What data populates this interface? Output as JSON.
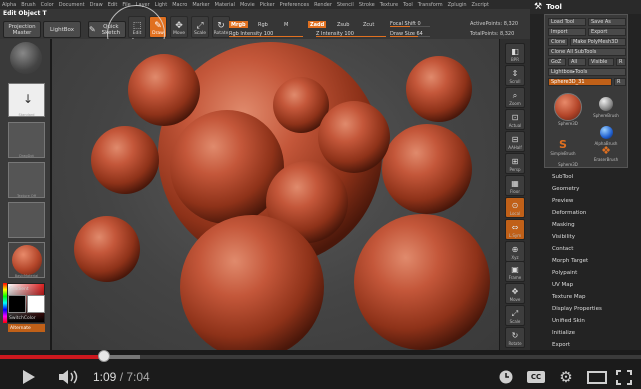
{
  "colors": {
    "accent": "#e07020",
    "sphere": "#b4462a",
    "progress": "#cc181e"
  },
  "menubar": [
    "Alpha",
    "Brush",
    "Color",
    "Document",
    "Draw",
    "Edit",
    "File",
    "Layer",
    "Light",
    "Macro",
    "Marker",
    "Material",
    "Movie",
    "Picker",
    "Preferences",
    "Render",
    "Stencil",
    "Stroke",
    "Texture",
    "Tool",
    "Transform",
    "Zplugin",
    "Zscript"
  ],
  "topbar": {
    "edit_object": "Edit Object  T",
    "projection_master": "Projection Master",
    "lightbox": "LightBox",
    "quick_sketch": "Quick Sketch",
    "edit": "Edit",
    "draw": "Draw",
    "move": "Move",
    "scale": "Scale",
    "rotate": "Rotate",
    "mrgb": "Mrgb",
    "rgb": "Rgb",
    "m": "M",
    "zadd": "Zadd",
    "zsub": "Zsub",
    "zcut": "Zcut",
    "rgb_intensity": "Rgb Intensity 100",
    "z_intensity": "Z Intensity 100",
    "focal_shift": "Focal Shift 0",
    "draw_size": "Draw Size 64",
    "active_points": "ActivePoints: 8,320",
    "total_points": "TotalPoints: 8,320"
  },
  "leftbar": {
    "thumb1": "Standard",
    "thumb2": "DragDot",
    "thumb3": "Texture Off",
    "thumb4": "Alpha Off",
    "thumb5": "BasicMaterial",
    "gradient": "Gradient",
    "switchcolor": "SwitchColor",
    "alternate": "Alternate"
  },
  "rightshelf": [
    "BPR",
    "Scroll",
    "Zoom",
    "Actual",
    "AAHalf",
    "Persp",
    "Floor",
    "Local",
    "L.Sym",
    "Xyz",
    "Frame",
    "Move",
    "Scale",
    "Rotate"
  ],
  "toolpanel": {
    "title": "Tool",
    "load_tool": "Load Tool",
    "save_as": "Save As",
    "import": "Import",
    "export": "Export",
    "clone": "Clone",
    "make_polymesh": "Make PolyMesh3D",
    "clone_all": "Clone All SubTools",
    "goz": "GoZ",
    "all": "All",
    "visible": "Visible",
    "r": "R",
    "lightbox_tools": "Lightbox▸Tools",
    "sphere3d": "Sphere3D_31",
    "r2": "R",
    "sphere3d_label": "Sphere3D",
    "spherebrush": "SphereBrush",
    "alphabrush": "AlphaBrush",
    "simplebrush": "SimpleBrush",
    "erasorbrush": "EraserBrush",
    "sphere3d_small": "Sphere3D",
    "menu": [
      "SubTool",
      "Geometry",
      "Preview",
      "Deformation",
      "Masking",
      "Visibility",
      "Contact",
      "Morph Target",
      "Polypaint",
      "UV Map",
      "Texture Map",
      "Display Properties",
      "Unified Skin",
      "Initialize",
      "Export"
    ]
  },
  "player": {
    "current_time": "1:09",
    "separator": " / ",
    "duration": "7:04",
    "played_fraction": 0.163,
    "buffered_fraction": 0.218,
    "play_icon": "play-icon",
    "volume_icon": "volume-icon",
    "watch_later_icon": "clock-icon",
    "captions_label": "CC",
    "settings_icon": "gear-icon",
    "size_icon": "theater-icon",
    "fullscreen_icon": "fullscreen-icon"
  }
}
